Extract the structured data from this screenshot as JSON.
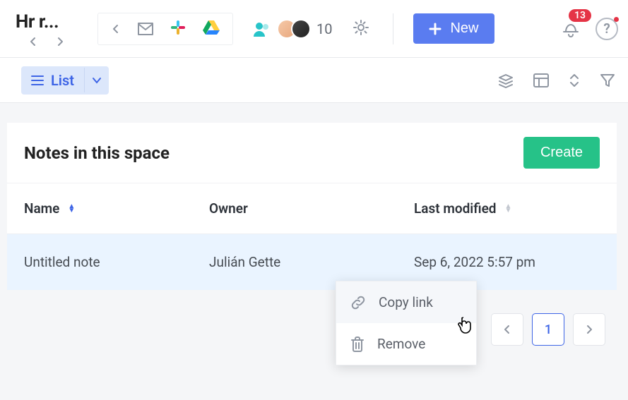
{
  "header": {
    "title": "Hr r...",
    "people_count": "10",
    "notification_count": "13",
    "new_button": "New"
  },
  "viewbar": {
    "list_label": "List"
  },
  "panel": {
    "title": "Notes in this space",
    "create_button": "Create"
  },
  "columns": {
    "name": "Name",
    "owner": "Owner",
    "modified": "Last modified"
  },
  "rows": [
    {
      "name": "Untitled note",
      "owner": "Julián Gette",
      "modified": "Sep 6, 2022 5:57 pm"
    }
  ],
  "context_menu": {
    "copy_link": "Copy link",
    "remove": "Remove"
  },
  "pager": {
    "current": "1"
  }
}
